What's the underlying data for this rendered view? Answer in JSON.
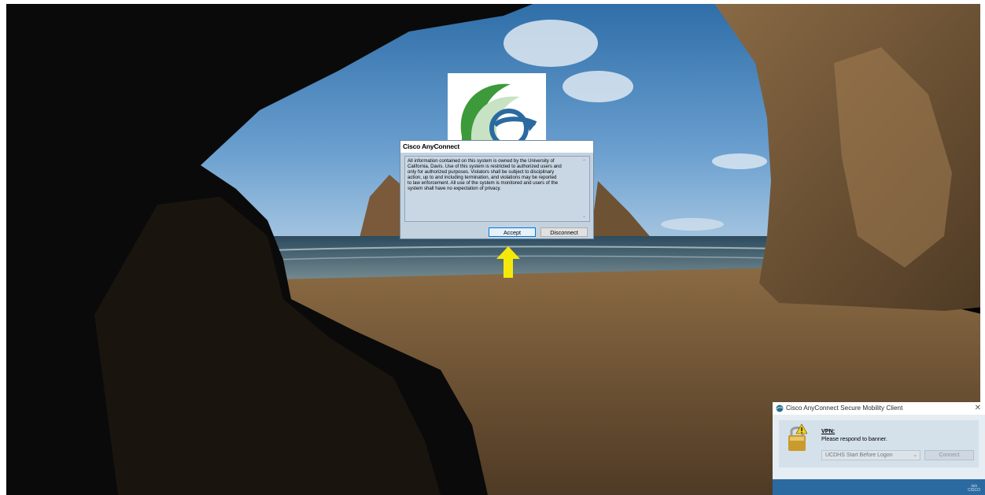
{
  "banner_dialog": {
    "title": "Cisco AnyConnect",
    "message": "All information contained on this system is owned by the University of\nCalifornia, Davis. Use of this system is restricted to authorized users and\nonly for authorized purposes. Violators shall be subject to disciplinary\naction, up to and including termination, and violations may be reported\nto law enforcement. All use of the system is monitored and users of the\nsystem shall have no expectation of privacy.",
    "accept_label": "Accept",
    "disconnect_label": "Disconnect"
  },
  "vpn_client": {
    "title": "Cisco AnyConnect Secure Mobility Client",
    "close_glyph": "✕",
    "section_label": "VPN:",
    "status": "Please respond to banner.",
    "profile": "UCDHS Start Before Logon",
    "connect_label": "Connect",
    "brand_line1": "ılıılı",
    "brand_line2": "CISCO"
  },
  "colors": {
    "accent_arrow": "#f5e90a",
    "cisco_blue": "#2a6aa0",
    "cisco_green": "#3c9a3a"
  }
}
